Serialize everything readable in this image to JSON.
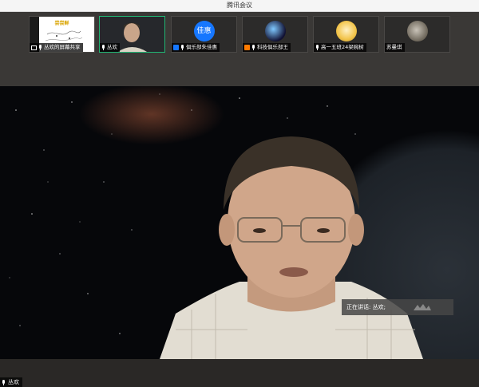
{
  "window": {
    "title": "腾讯会议"
  },
  "participants": [
    {
      "label": "丛欢的屏幕共享",
      "type": "screen-share"
    },
    {
      "label": "丛欢",
      "type": "video"
    },
    {
      "label": "俱乐部朱佳惠",
      "type": "avatar",
      "avatar_text": "佳惠",
      "avatar_color": "#1677ff"
    },
    {
      "label": "科技俱乐部王",
      "type": "avatar"
    },
    {
      "label": "高一五班24梁婉树",
      "type": "avatar"
    },
    {
      "label": "苏曼琪",
      "type": "avatar"
    }
  ],
  "share_slide": {
    "title": "尝尝鲜"
  },
  "main_video": {
    "speaking_label": "正在讲话: 丛欢;",
    "name_tag": "丛欢"
  },
  "colors": {
    "active_border": "#21b573",
    "accent": "#1677ff",
    "share_icon_bg": "#ff7a00"
  }
}
